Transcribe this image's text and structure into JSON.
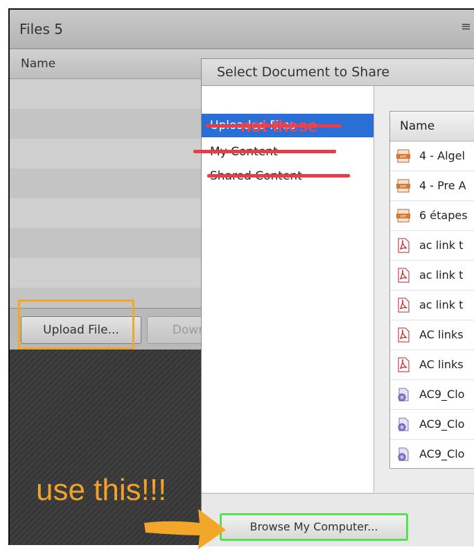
{
  "files_pod": {
    "title": "Files 5",
    "menu_icon": "≡",
    "column_header": "Name",
    "upload_button": "Upload File...",
    "download_button": "Down"
  },
  "dialog": {
    "title": "Select Document to Share",
    "nav_items": [
      {
        "label": "Uploaded Files",
        "selected": true
      },
      {
        "label": "My Content",
        "selected": false
      },
      {
        "label": "Shared Content",
        "selected": false
      }
    ],
    "file_column_header": "Name",
    "files": [
      {
        "name": "4 - Algel",
        "icon": "ppt-icon"
      },
      {
        "name": "4 - Pre A",
        "icon": "ppt-icon"
      },
      {
        "name": "6 étapes",
        "icon": "ppt-icon"
      },
      {
        "name": "ac link t",
        "icon": "pdf-icon"
      },
      {
        "name": "ac link t",
        "icon": "pdf-icon"
      },
      {
        "name": "ac link t",
        "icon": "pdf-icon"
      },
      {
        "name": "AC links",
        "icon": "pdf-icon"
      },
      {
        "name": "AC links",
        "icon": "pdf-icon"
      },
      {
        "name": "AC9_Clo",
        "icon": "swf-icon"
      },
      {
        "name": "AC9_Clo",
        "icon": "swf-icon"
      },
      {
        "name": "AC9_Clo",
        "icon": "swf-icon"
      }
    ],
    "browse_button": "Browse My Computer..."
  },
  "annotations": {
    "not_these": "not these",
    "use_this": "use this!!!",
    "strike_color": "#e63d4b",
    "upload_highlight_color": "#f2a72a",
    "browse_highlight_color": "#57e050"
  }
}
